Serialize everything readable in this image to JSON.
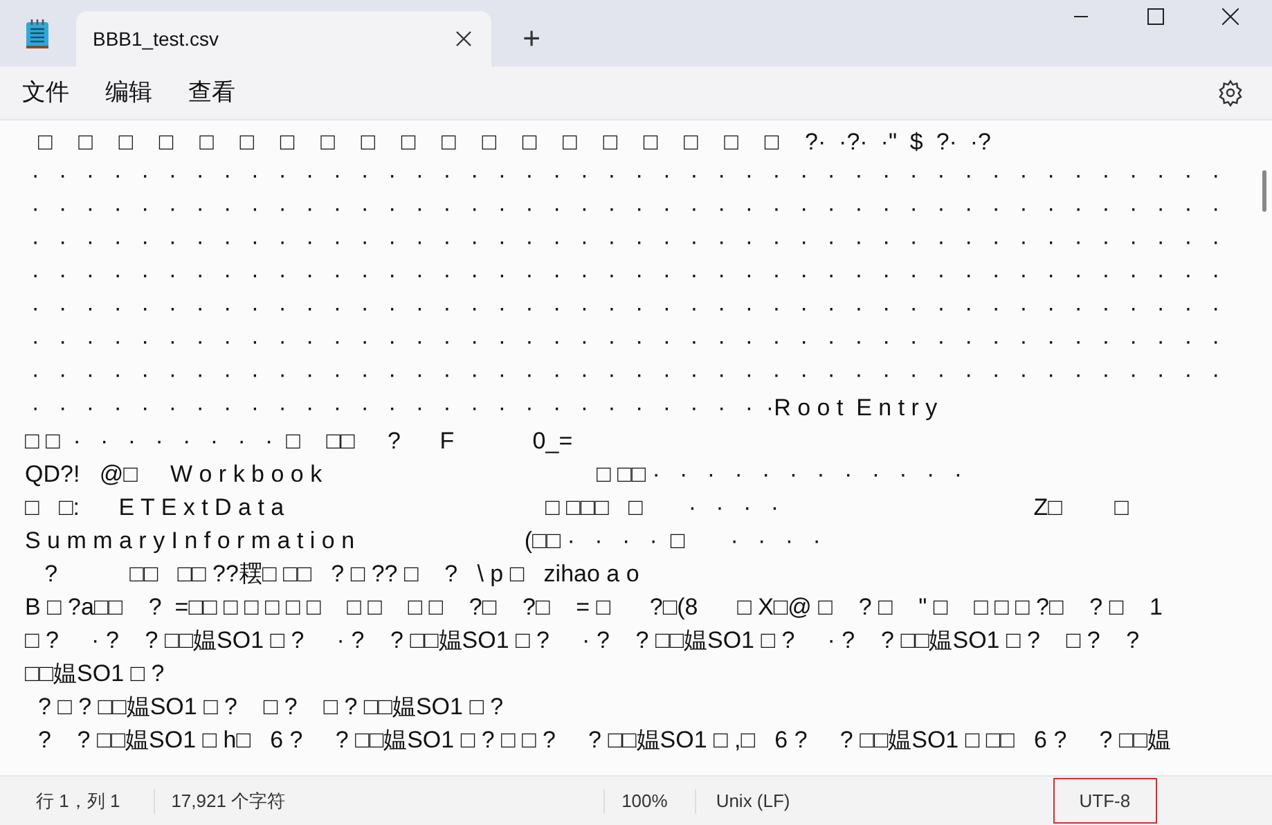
{
  "tabs": [
    {
      "label": "BBB1_test.csv",
      "selected": true
    }
  ],
  "new_tab": "+",
  "menu": [
    "文件",
    "编辑",
    "查看"
  ],
  "editor": {
    "lines": [
      "  □    □    □    □    □    □    □    □    □    □    □    □    □    □    □    □    □    □    □    ?·  ·?·  ·\"  $  ?·  ·?",
      " ·   ·   ·   ·   ·   ·   ·   ·   ·   ·   ·   ·   ·   ·   ·   ·   ·   ·   ·   ·   ·   ·   ·   ·   ·   ·   ·   ·   ·   ·   ·   ·   ·   ·   ·   ·   ·   ·   ·   ·   ·   ·   ·   ·",
      " ·   ·   ·   ·   ·   ·   ·   ·   ·   ·   ·   ·   ·   ·   ·   ·   ·   ·   ·   ·   ·   ·   ·   ·   ·   ·   ·   ·   ·   ·   ·   ·   ·   ·   ·   ·   ·   ·   ·   ·   ·   ·   ·   ·",
      " ·   ·   ·   ·   ·   ·   ·   ·   ·   ·   ·   ·   ·   ·   ·   ·   ·   ·   ·   ·   ·   ·   ·   ·   ·   ·   ·   ·   ·   ·   ·   ·   ·   ·   ·   ·   ·   ·   ·   ·   ·   ·   ·   ·",
      " ·   ·   ·   ·   ·   ·   ·   ·   ·   ·   ·   ·   ·   ·   ·   ·   ·   ·   ·   ·   ·   ·   ·   ·   ·   ·   ·   ·   ·   ·   ·   ·   ·   ·   ·   ·   ·   ·   ·   ·   ·   ·   ·   ·",
      " ·   ·   ·   ·   ·   ·   ·   ·   ·   ·   ·   ·   ·   ·   ·   ·   ·   ·   ·   ·   ·   ·   ·   ·   ·   ·   ·   ·   ·   ·   ·   ·   ·   ·   ·   ·   ·   ·   ·   ·   ·   ·   ·   ·",
      " ·   ·   ·   ·   ·   ·   ·   ·   ·   ·   ·   ·   ·   ·   ·   ·   ·   ·   ·   ·   ·   ·   ·   ·   ·   ·   ·   ·   ·   ·   ·   ·   ·   ·   ·   ·   ·   ·   ·   ·   ·   ·   ·   ·",
      " ·   ·   ·   ·   ·   ·   ·   ·   ·   ·   ·   ·   ·   ·   ·   ·   ·   ·   ·   ·   ·   ·   ·   ·   ·   ·   ·   ·   ·   ·   ·   ·   ·   ·   ·   ·   ·   ·   ·   ·   ·   ·   ·   ·",
      " ·   ·   ·   ·   ·   ·   ·   ·   ·   ·   ·   ·   ·   ·   ·   ·   ·   ·   ·   ·   ·   ·   ·   ·   ·   ·   ·  ·R o o t  E n t r y",
      "□ □  ·   ·   ·   ·   ·   ·   ·   ·  □    □□     ?      F            0_=",
      "QD?!   @□     W o r k b o o k                                          □ □□ ·   ·   ·   ·   ·   ·   ·   ·   ·   ·   ·   ·",
      "□   □:      E T E x t D a t a                                        □ □□□   □       ·   ·   ·   ·                                       Z□        □",
      "S u m m a r y I n f o r m a t i o n                          (□□ ·   ·   ·   ·  □       ·   ·   ·   ·",
      "   ?           □□   □□ ??䎬□ □□   ? □ ?? □    ?   \\ p □   zihao a o",
      "B □ ?a□□    ?  =□□ □ □ □ □ □    □ □    □ □    ?□    ?□    = □      ?□(8      □ X□@ □    ? □    \" □    □ □ □ ?□    ? □    1",
      "□ ?     · ?    ? □□媪SO1 □ ?     · ?    ? □□媪SO1 □ ?     · ?    ? □□媪SO1 □ ?     · ?    ? □□媪SO1 □ ?    □ ?    ?",
      "□□媪SO1 □ ?",
      "  ? □ ? □□媪SO1 □ ?    □ ?    □ ? □□媪SO1 □ ?",
      "  ?    ? □□媪SO1 □ h□   6 ?     ? □□媪SO1 □ ? □ □ ?     ? □□媪SO1 □ ,□   6 ?     ? □□媪SO1 □ □□   6 ?     ? □□媪"
    ]
  },
  "status_bar": {
    "position": "行 1，列 1",
    "characters": "17,921 个字符",
    "zoom": "100%",
    "line_ending": "Unix (LF)",
    "encoding": {
      "label": "UTF-8",
      "highlighted": true
    }
  }
}
